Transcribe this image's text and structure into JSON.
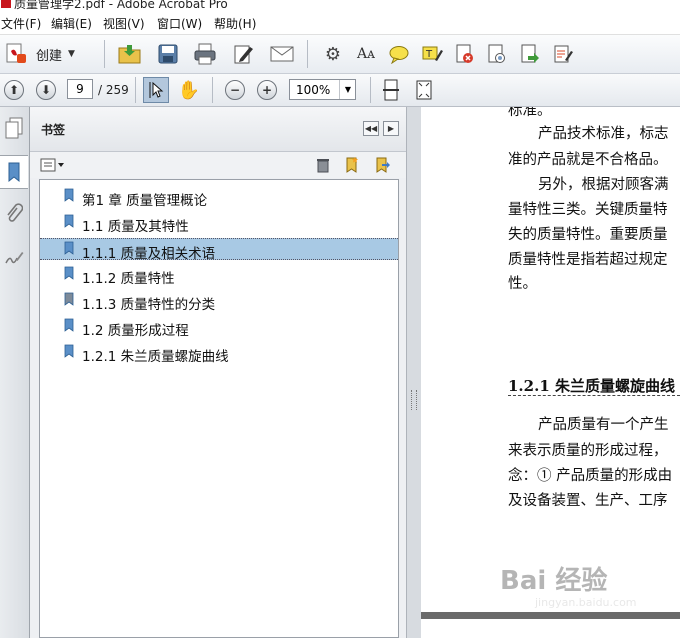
{
  "window": {
    "title": "质量管理学2.pdf - Adobe Acrobat Pro"
  },
  "menu": [
    "文件(F)",
    "编辑(E)",
    "视图(V)",
    "窗口(W)",
    "帮助(H)"
  ],
  "toolbar": {
    "create_label": "创建"
  },
  "navigation": {
    "current_page": "9",
    "total_pages": "/ 259",
    "zoom": "100%"
  },
  "bookmarks": {
    "panel_title": "书签",
    "items": [
      {
        "label": "第1 章 质量管理概论",
        "selected": false
      },
      {
        "label": "1.1 质量及其特性",
        "selected": false
      },
      {
        "label": "1.1.1 质量及相关术语",
        "selected": true
      },
      {
        "label": "1.1.2 质量特性",
        "selected": false
      },
      {
        "label": "1.1.3 质量特性的分类",
        "selected": false
      },
      {
        "label": "1.2 质量形成过程",
        "selected": false
      },
      {
        "label": "1.2.1 朱兰质量螺旋曲线",
        "selected": false
      }
    ]
  },
  "document": {
    "lines": [
      "标准。",
      "产品技术标准，标志",
      "准的产品就是不合格品。",
      "另外，根据对顾客满",
      "量特性三类。关键质量特",
      "失的质量特性。重要质量",
      "质量特性是指若超过规定",
      "性。"
    ],
    "heading": "1.2.1  朱兰质量螺旋曲线",
    "lines2": [
      "产品质量有一个产生",
      "来表示质量的形成过程，",
      "念：① 产品质量的形成由",
      "及设备装置、生产、工序"
    ]
  },
  "watermark": {
    "text": "Bai 经验",
    "sub": "jingyan.baidu.com"
  },
  "colors": {
    "selection": "#a8c9e4",
    "bookmark_icon": "#5a8fc7",
    "pdf_red": "#c8161d"
  }
}
